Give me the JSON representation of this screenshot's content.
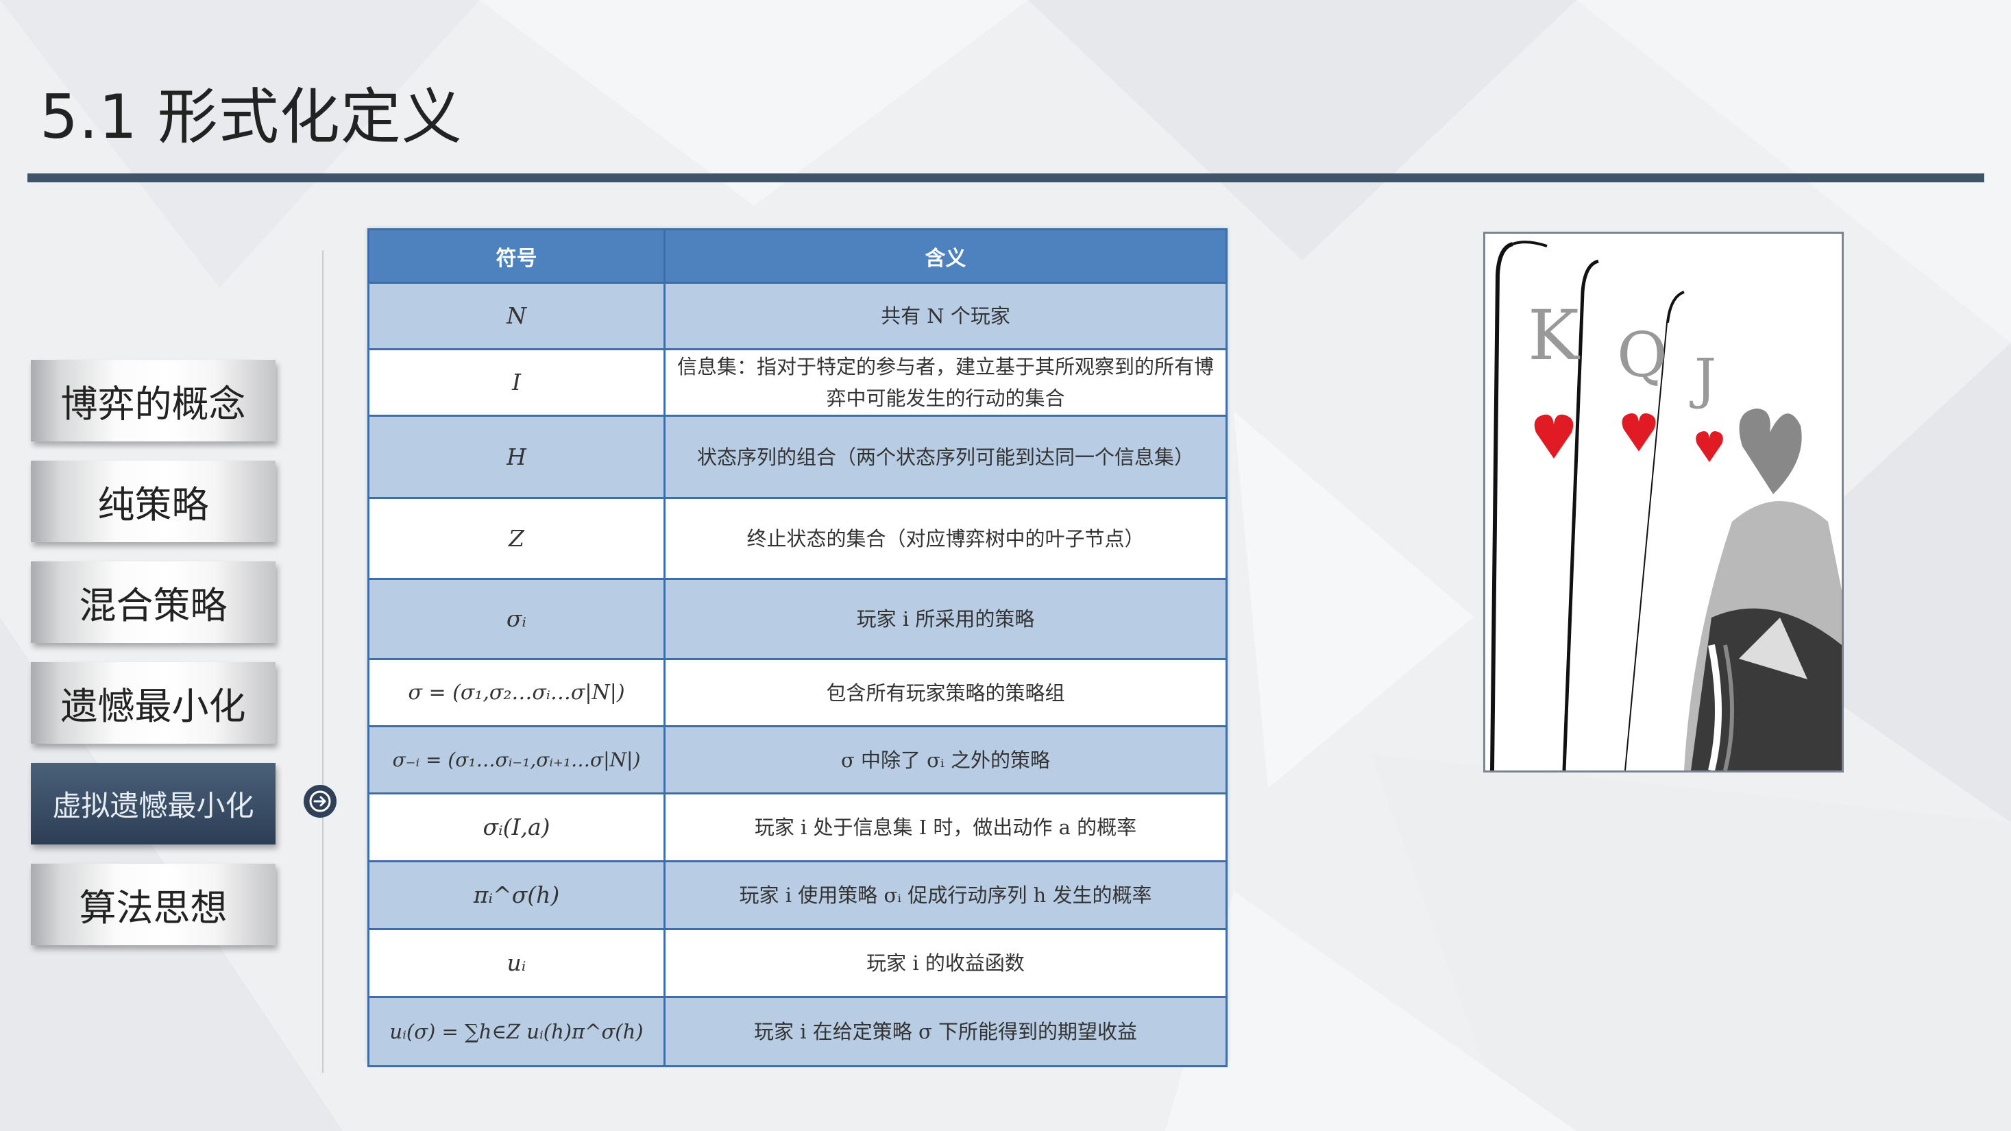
{
  "title": "5.1 形式化定义",
  "nav": {
    "items": [
      {
        "label": "博弈的概念",
        "active": false
      },
      {
        "label": "纯策略",
        "active": false
      },
      {
        "label": "混合策略",
        "active": false
      },
      {
        "label": "遗憾最小化",
        "active": false
      },
      {
        "label": "虚拟遗憾最小化",
        "active": true
      },
      {
        "label": "算法思想",
        "active": false
      }
    ],
    "arrow_icon": "arrow-right-circle-icon"
  },
  "table": {
    "headers": [
      "符号",
      "含义"
    ],
    "rows": [
      {
        "symbol": "N",
        "meaning": "共有 N 个玩家"
      },
      {
        "symbol": "I",
        "meaning": "信息集：指对于特定的参与者，建立基于其所观察到的所有博弈中可能发生的行动的集合"
      },
      {
        "symbol": "H",
        "meaning": "状态序列的组合（两个状态序列可能到达同一个信息集）"
      },
      {
        "symbol": "Z",
        "meaning": "终止状态的集合（对应博弈树中的叶子节点）"
      },
      {
        "symbol": "σᵢ",
        "meaning": "玩家 i 所采用的策略"
      },
      {
        "symbol": "σ = (σ₁,σ₂…σᵢ…σ|N|)",
        "meaning": "包含所有玩家策略的策略组"
      },
      {
        "symbol": "σ₋ᵢ = (σ₁…σᵢ₋₁,σᵢ₊₁…σ|N|)",
        "meaning": "σ 中除了 σᵢ 之外的策略"
      },
      {
        "symbol": "σᵢ(I,a)",
        "meaning": "玩家 i 处于信息集 I 时，做出动作 a 的概率"
      },
      {
        "symbol": "πᵢ^σ(h)",
        "meaning": "玩家 i 使用策略 σᵢ 促成行动序列 h 发生的概率"
      },
      {
        "symbol": "uᵢ",
        "meaning": "玩家 i 的收益函数"
      },
      {
        "symbol": "uᵢ(σ) = ∑h∈Z uᵢ(h)π^σ(h)",
        "meaning": "玩家 i 在给定策略 σ 下所能得到的期望收益"
      }
    ]
  },
  "image": {
    "cards": [
      "K",
      "Q",
      "J"
    ],
    "suit_color": "#e01b24"
  },
  "colors": {
    "title_rule": "#3f5369",
    "header_bg": "#4e82bf",
    "row_shade": "#b8cde4",
    "active_nav": "#2c3e55"
  }
}
